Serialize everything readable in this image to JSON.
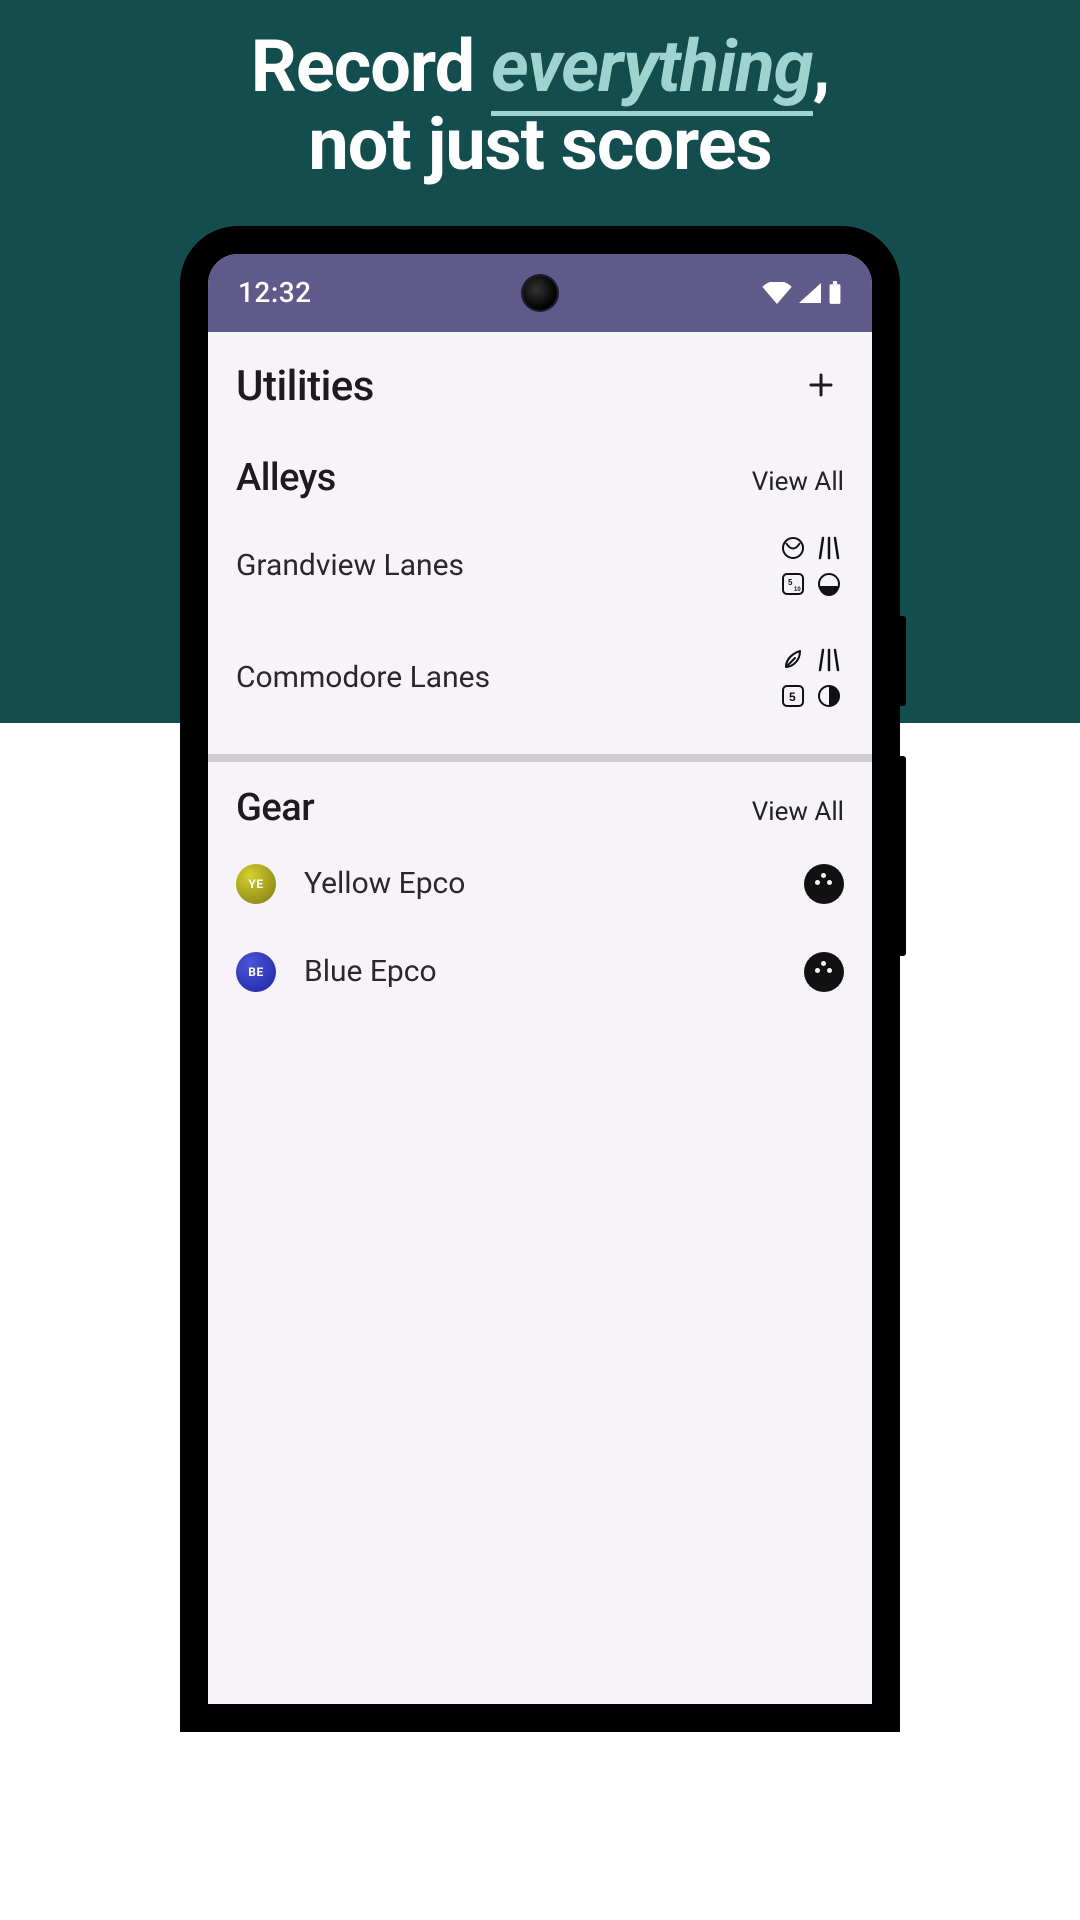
{
  "promo": {
    "line1_prefix": "Record ",
    "line1_emph": "everything",
    "line1_suffix": ",",
    "line2": "not just scores"
  },
  "status_bar": {
    "time": "12:32"
  },
  "header": {
    "title": "Utilities",
    "add_icon": "plus-icon"
  },
  "sections": {
    "alleys": {
      "title": "Alleys",
      "view_all": "View All",
      "items": [
        {
          "name": "Grandview Lanes"
        },
        {
          "name": "Commodore Lanes"
        }
      ]
    },
    "gear": {
      "title": "Gear",
      "view_all": "View All",
      "items": [
        {
          "name": "Yellow Epco",
          "initials": "YE",
          "avatar_bg": "radial-gradient(circle at 35% 30%, #d7cf2e, #7a7a10)"
        },
        {
          "name": "Blue Epco",
          "initials": "BE",
          "avatar_bg": "radial-gradient(circle at 35% 30%, #4a55d8, #1d24a0)"
        }
      ]
    }
  },
  "colors": {
    "teal": "#134d4d",
    "appbar": "#605a8a",
    "screen": "#f7f4f9"
  }
}
